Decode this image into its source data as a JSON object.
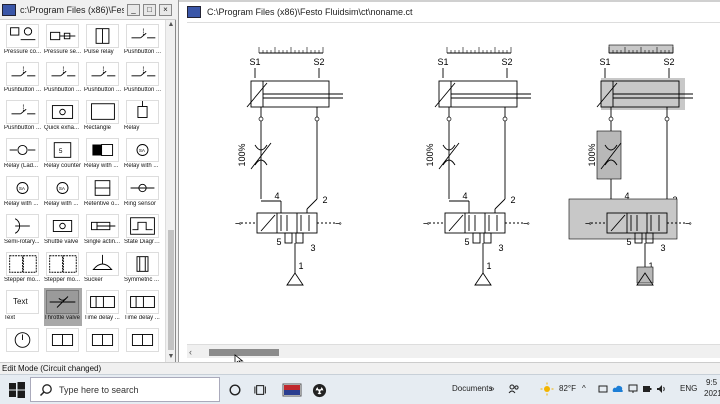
{
  "library": {
    "title": "c:\\Program Files (x86)\\Festo Fluidsim\\...",
    "window_buttons": [
      "_",
      "□",
      "×"
    ],
    "tiles": [
      {
        "label": "Pressure co...",
        "icon": "pressure-switch-icon"
      },
      {
        "label": "Pressure se...",
        "icon": "pressure-sensor-icon"
      },
      {
        "label": "Pulse relay",
        "icon": "pulse-relay-icon"
      },
      {
        "label": "Pushbutton ...",
        "icon": "pushbutton-icon"
      },
      {
        "label": "Pushbutton ...",
        "icon": "pushbutton-icon"
      },
      {
        "label": "Pushbutton ...",
        "icon": "pushbutton-icon"
      },
      {
        "label": "Pushbutton ...",
        "icon": "pushbutton-icon"
      },
      {
        "label": "Pushbutton ...",
        "icon": "pushbutton-icon"
      },
      {
        "label": "Pushbutton ...",
        "icon": "pushbutton-icon"
      },
      {
        "label": "Quick exha...",
        "icon": "quick-exhaust-valve-icon"
      },
      {
        "label": "Rectangle",
        "icon": "rectangle-icon"
      },
      {
        "label": "Relay",
        "icon": "relay-icon"
      },
      {
        "label": "Relay (Lad...",
        "icon": "relay-ladder-icon"
      },
      {
        "label": "Relay counter",
        "icon": "relay-counter-icon"
      },
      {
        "label": "Relay with ...",
        "icon": "relay-delay-icon"
      },
      {
        "label": "Relay with ...",
        "icon": "relay-with-icon"
      },
      {
        "label": "Relay with ...",
        "icon": "relay-with-icon"
      },
      {
        "label": "Relay with ...",
        "icon": "relay-with-icon"
      },
      {
        "label": "Retentive o...",
        "icon": "retentive-icon"
      },
      {
        "label": "Ring sensor",
        "icon": "ring-sensor-icon"
      },
      {
        "label": "Semi-rotary...",
        "icon": "semi-rotary-actuator-icon"
      },
      {
        "label": "Shuttle valve",
        "icon": "shuttle-valve-icon"
      },
      {
        "label": "Single actin...",
        "icon": "single-acting-cylinder-icon"
      },
      {
        "label": "State Diagram",
        "icon": "state-diagram-icon"
      },
      {
        "label": "Stepper mo...",
        "icon": "stepper-module-icon"
      },
      {
        "label": "Stepper mo...",
        "icon": "stepper-module-icon"
      },
      {
        "label": "Sucker",
        "icon": "sucker-icon"
      },
      {
        "label": "Symmetric ...",
        "icon": "symmetric-icon"
      },
      {
        "label": "Text",
        "icon": "text-icon",
        "glyph": "Text"
      },
      {
        "label": "Throttle valve",
        "icon": "throttle-valve-icon",
        "selected": true
      },
      {
        "label": "Time delay ...",
        "icon": "time-delay-valve-icon"
      },
      {
        "label": "Time delay ...",
        "icon": "time-delay-valve-icon"
      },
      {
        "label": "",
        "icon": "timer-icon"
      },
      {
        "label": "",
        "icon": "valve-icon"
      },
      {
        "label": "",
        "icon": "valve-icon"
      },
      {
        "label": "",
        "icon": "valve-icon"
      }
    ]
  },
  "main": {
    "title": "C:\\Program Files (x86)\\Festo Fluidsim\\ct\\noname.ct",
    "circuits": [
      {
        "s1": "S1",
        "s2": "S2",
        "pct": "100%",
        "port_a": "4",
        "port_b": "2",
        "port_c": "5",
        "port_d": "3",
        "port_e": "1"
      },
      {
        "s1": "S1",
        "s2": "S2",
        "pct": "100%",
        "port_a": "4",
        "port_b": "2",
        "port_c": "5",
        "port_d": "3",
        "port_e": "1"
      },
      {
        "s1": "S1",
        "s2": "S2",
        "pct": "100%",
        "port_a": "4",
        "port_b": "2",
        "port_c": "5",
        "port_d": "3",
        "port_e": "1"
      }
    ]
  },
  "status": {
    "text": "Edit Mode (Circuit changed)"
  },
  "taskbar": {
    "search_placeholder": "Type here to search",
    "tray": {
      "documents": "Documents",
      "chevron": "»",
      "weather": "82°F",
      "lang": "ENG",
      "time": "9:5",
      "date": "2021"
    }
  },
  "colors": {
    "selected_tile": "#a8a8a8",
    "highlight_fill": "#c8c8c8",
    "taskbar": "#e6ecf2",
    "app_icon": "#3a56a8"
  }
}
